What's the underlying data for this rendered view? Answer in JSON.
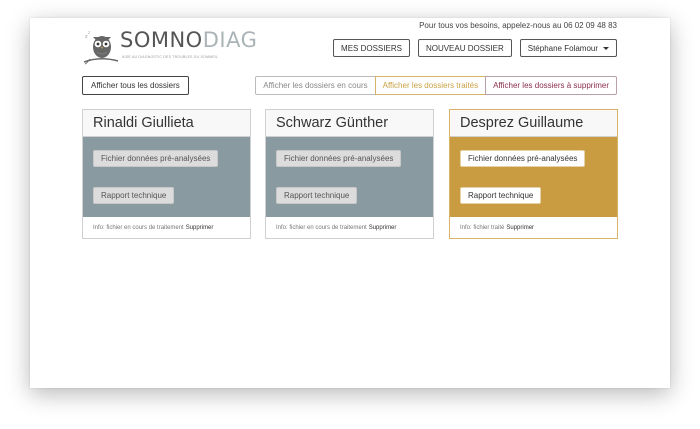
{
  "header": {
    "phone_text": "Pour tous vos besoins, appelez-nous au 06 02 09 48 83",
    "logo_main": "SOMNO",
    "logo_accent": "DIAG",
    "tagline": "AIDE AU DIAGNOSTIC DES TROUBLES DU SOMMEIL"
  },
  "nav": {
    "my_files": "MES DOSSIERS",
    "new_file": "NOUVEAU DOSSIER",
    "user": "Stéphane Folamour"
  },
  "filters": {
    "show_all": "Afficher tous les dossiers",
    "in_progress": "Afficher les dossiers en cours",
    "treated": "Afficher les dossiers traités",
    "to_delete": "Afficher les dossiers à supprimer"
  },
  "cards": [
    {
      "name": "Rinaldi Giullieta",
      "btn1": "Fichier données pré-analysées",
      "btn2": "Rapport technique",
      "info": "Info: fichier en cours de traitement",
      "delete": "Supprimer"
    },
    {
      "name": "Schwarz Günther",
      "btn1": "Fichier données pré-analysées",
      "btn2": "Rapport technique",
      "info": "Info: fichier en cours de traitement",
      "delete": "Supprimer"
    },
    {
      "name": "Desprez Guillaume",
      "btn1": "Fichier données pré-analysées",
      "btn2": "Rapport technique",
      "info": "Info: fichier traité",
      "delete": "Supprimer"
    }
  ],
  "colors": {
    "in_progress": "#8a9aa1",
    "treated": "#c99c41",
    "delete": "#8a2e4a"
  }
}
